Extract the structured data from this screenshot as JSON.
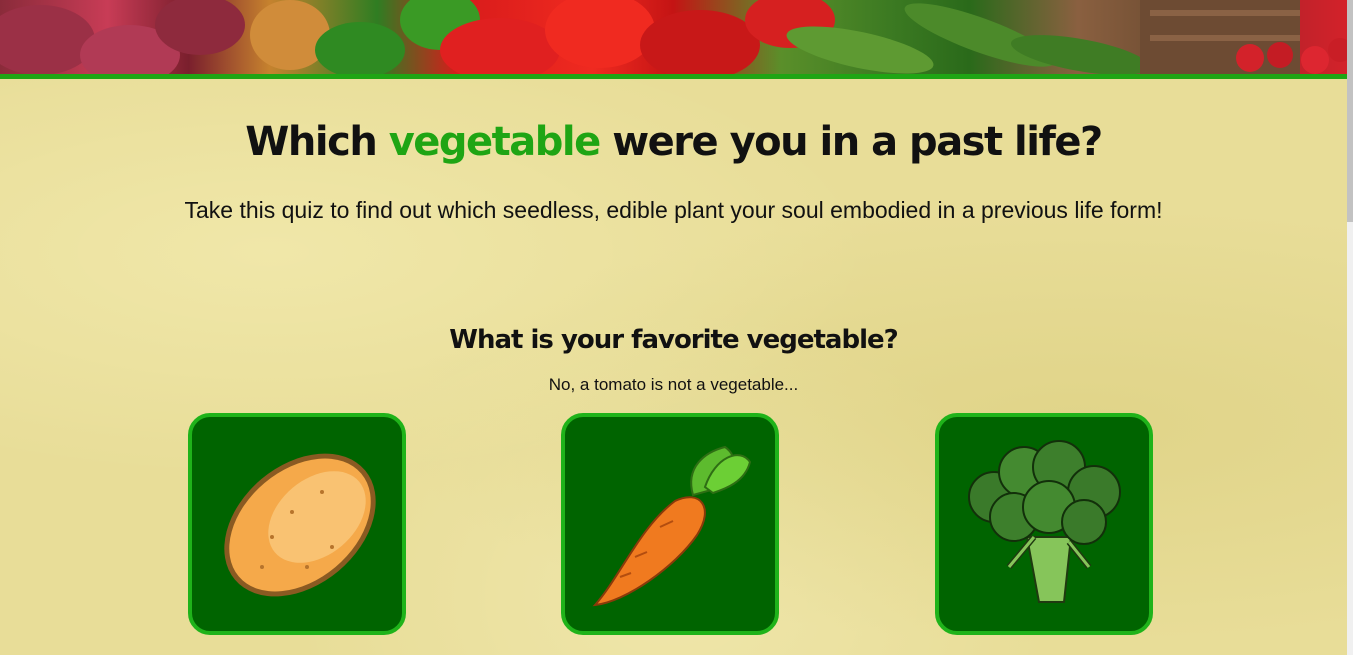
{
  "header": {
    "title_before": "Which ",
    "title_highlight": "vegetable",
    "title_after": " were you in a past life?",
    "subtitle": "Take this quiz to find out which seedless, edible plant your soul embodied in a previous life form!"
  },
  "question": {
    "text": "What is your favorite vegetable?",
    "note": "No, a tomato is not a vegetable..."
  },
  "options": [
    {
      "icon": "potato-icon"
    },
    {
      "icon": "carrot-icon"
    },
    {
      "icon": "broccoli-icon"
    }
  ],
  "colors": {
    "accent": "#1fa514",
    "card_bg": "#006400",
    "card_border": "#1fb31a",
    "page_bg": "#e8dd98"
  }
}
